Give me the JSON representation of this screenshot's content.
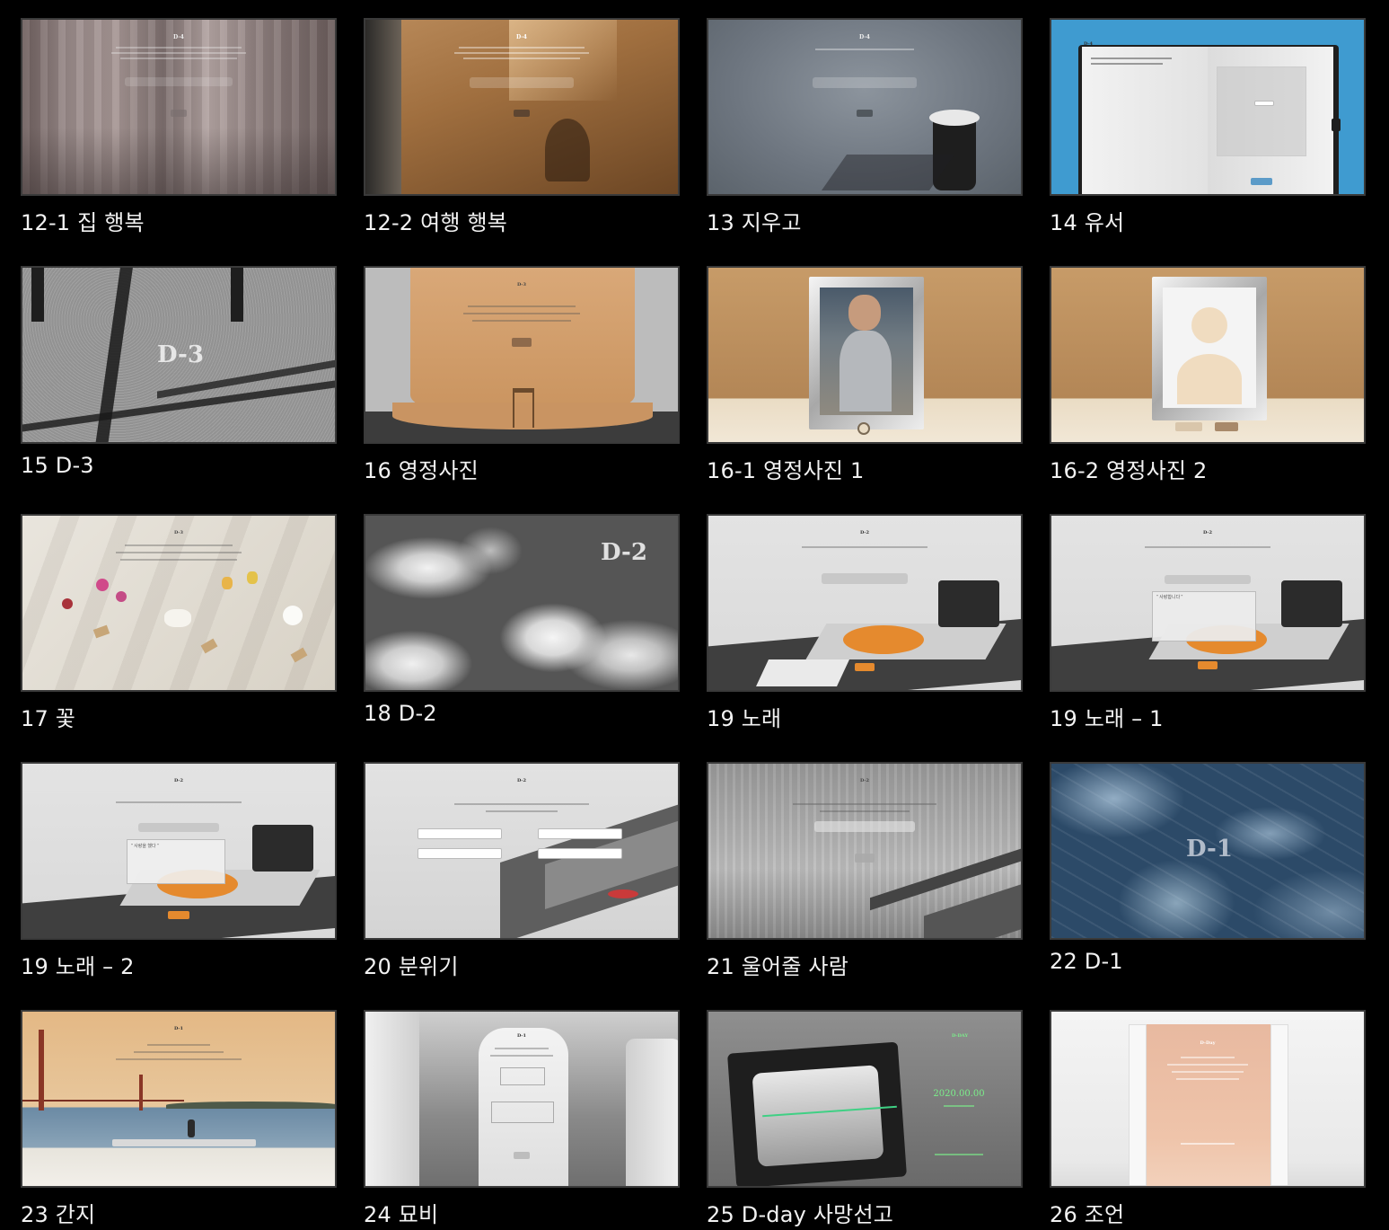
{
  "tiles": [
    {
      "caption": "12-1 집 행복",
      "d": "D-4"
    },
    {
      "caption": "12-2 여행 행복",
      "d": "D-4"
    },
    {
      "caption": "13 지우고",
      "d": "D-4"
    },
    {
      "caption": "14 유서",
      "d": "D-4"
    },
    {
      "caption": "15 D-3",
      "d": "D-3"
    },
    {
      "caption": "16 영정사진",
      "d": "D-3"
    },
    {
      "caption": "16-1 영정사진 1",
      "d": ""
    },
    {
      "caption": "16-2 영정사진 2",
      "d": ""
    },
    {
      "caption": "17 꽃",
      "d": "D-3"
    },
    {
      "caption": "18 D-2",
      "d": "D-2"
    },
    {
      "caption": "19 노래",
      "d": "D-2"
    },
    {
      "caption": "19 노래 – 1",
      "d": "D-2"
    },
    {
      "caption": "19 노래 – 2",
      "d": "D-2"
    },
    {
      "caption": "20 분위기",
      "d": "D-2"
    },
    {
      "caption": "21 울어줄 사람",
      "d": "D-2"
    },
    {
      "caption": "22 D-1",
      "d": "D-1"
    },
    {
      "caption": "23 간지",
      "d": "D-1"
    },
    {
      "caption": "24 묘비",
      "d": "D-1"
    },
    {
      "caption": "25 D-day 사망선고",
      "d": "D-DAY"
    },
    {
      "caption": "26 조언",
      "d": "D-Day"
    }
  ],
  "details": {
    "d25_date": "2020.00.00",
    "song_pick": "\" 사랑합니다 \"",
    "song_pick2": "\" 사랑을 했다 \""
  }
}
